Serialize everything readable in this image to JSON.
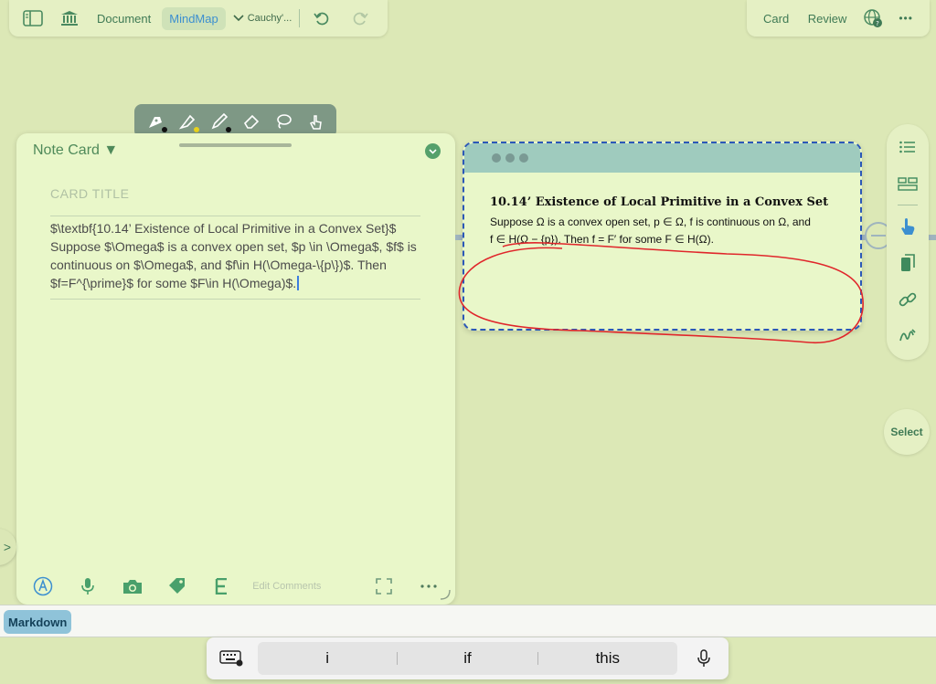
{
  "toolbar": {
    "document": "Document",
    "mindmap": "MindMap",
    "doc_name": "Cauchy'...",
    "card": "Card",
    "review": "Review",
    "more": "•••"
  },
  "note_card": {
    "header": "Note Card ▼",
    "card_title_placeholder": "CARD TITLE",
    "content": "$\\textbf{10.14’ Existence of Local Primitive in a Convex Set}$ Suppose $\\Omega$ is a convex open set, $p \\in \\Omega$, $f$ is continuous on $\\Omega$, and $f\\in H(\\Omega-\\{p\\})$. Then $f=F^{\\prime}$ for some $F\\in H(\\Omega)$.",
    "edit_comments": "Edit Comments",
    "edge_tab": ">"
  },
  "mindmap_card": {
    "title": "10.14’ Existence of Local Primitive in a Convex Set",
    "line1": "Suppose Ω is a convex open set, p ∈ Ω, f is continuous on Ω, and",
    "line2": "f ∈ H(Ω − {p}). Then f = F′ for some F ∈ H(Ω)."
  },
  "sidebar": {
    "select": "Select"
  },
  "markdown": {
    "label": "Markdown"
  },
  "keyboard": {
    "suggestions": [
      "i",
      "if",
      "this"
    ]
  },
  "colors": {
    "background": "#dce8b6",
    "panel": "#e9f7c9",
    "accent_green": "#3f7a55",
    "mindmap_border": "#2b58b8",
    "scribble": "#e0262b"
  }
}
